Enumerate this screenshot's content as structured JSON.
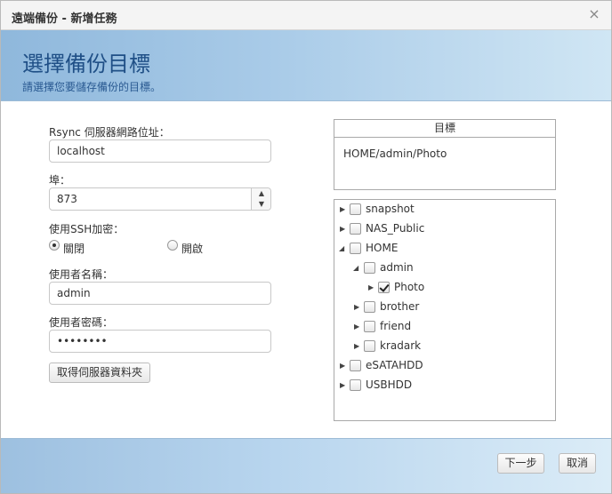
{
  "window": {
    "title": "遠端備份 - 新增任務",
    "close_glyph": "×"
  },
  "header": {
    "title": "選擇備份目標",
    "subtitle": "請選擇您要儲存備份的目標。"
  },
  "form": {
    "server_label": "Rsync 伺服器網路位址：",
    "server_value": "localhost",
    "port_label": "埠：",
    "port_value": "873",
    "ssh_label": "使用SSH加密：",
    "ssh_off_label": "關閉",
    "ssh_on_label": "開啟",
    "ssh_selected": "關閉",
    "username_label": "使用者名稱：",
    "username_value": "admin",
    "password_label": "使用者密碼：",
    "password_value": "••••••••",
    "get_folders_label": "取得伺服器資料夾"
  },
  "target": {
    "header": "目標",
    "value": "HOME/admin/Photo"
  },
  "tree": {
    "nodes": [
      {
        "label": "snapshot",
        "expanded": false,
        "checked": false
      },
      {
        "label": "NAS_Public",
        "expanded": false,
        "checked": false
      },
      {
        "label": "HOME",
        "expanded": true,
        "checked": false
      },
      {
        "label": "admin",
        "expanded": true,
        "checked": false
      },
      {
        "label": "Photo",
        "expanded": false,
        "checked": true
      },
      {
        "label": "brother",
        "expanded": false,
        "checked": false
      },
      {
        "label": "friend",
        "expanded": false,
        "checked": false
      },
      {
        "label": "kradark",
        "expanded": false,
        "checked": false
      },
      {
        "label": "eSATAHDD",
        "expanded": false,
        "checked": false
      },
      {
        "label": "USBHDD",
        "expanded": false,
        "checked": false
      }
    ]
  },
  "footer": {
    "next_label": "下一步",
    "cancel_label": "取消"
  },
  "icons": {
    "collapsed": "collapsed-arrow-icon",
    "expanded": "expanded-arrow-icon",
    "spin_up": "spin-up-icon",
    "spin_down": "spin-down-icon"
  },
  "colors": {
    "header_title": "#1f4f86",
    "header_band": "#a9cbe8"
  }
}
